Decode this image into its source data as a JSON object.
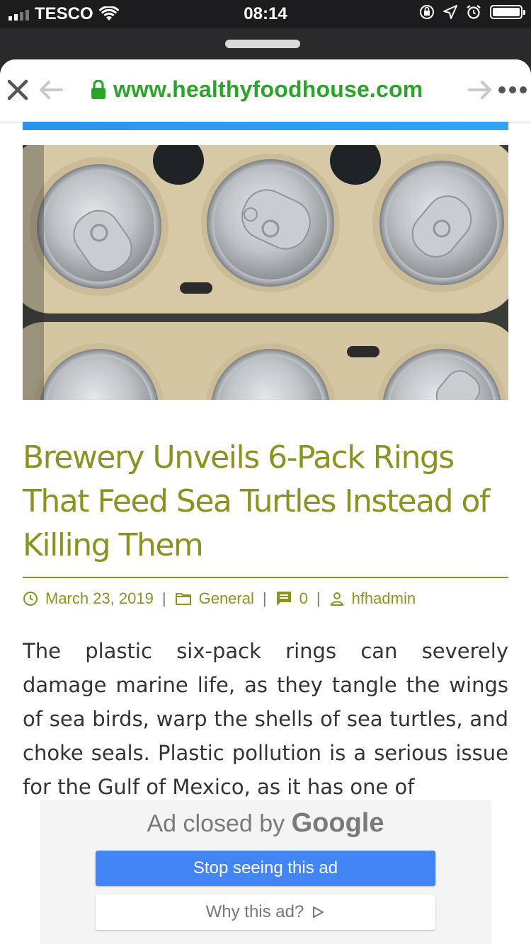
{
  "status_bar": {
    "carrier": "TESCO",
    "time": "08:14"
  },
  "browser": {
    "url": "www.healthyfoodhouse.com"
  },
  "article": {
    "title": "Brewery Unveils 6-Pack Rings That Feed Sea Turtles Instead of Killing Them",
    "date": "March 23, 2019",
    "category": "General",
    "comments": "0",
    "author": "hfhadmin",
    "body": "The plastic six-pack rings can severely damage marine life, as they tangle the wings of sea birds, warp the shells of sea turtles, and choke seals.  Plastic pollution is a serious issue for the Gulf of Mexico, as it has one of"
  },
  "ad": {
    "closed_prefix": "Ad closed by",
    "closed_brand": "Google",
    "stop_label": "Stop seeing this ad",
    "why_label": "Why this ad?"
  },
  "colors": {
    "title": "#8b9320",
    "url": "#2aa52a",
    "ad_button": "#4285f4"
  }
}
